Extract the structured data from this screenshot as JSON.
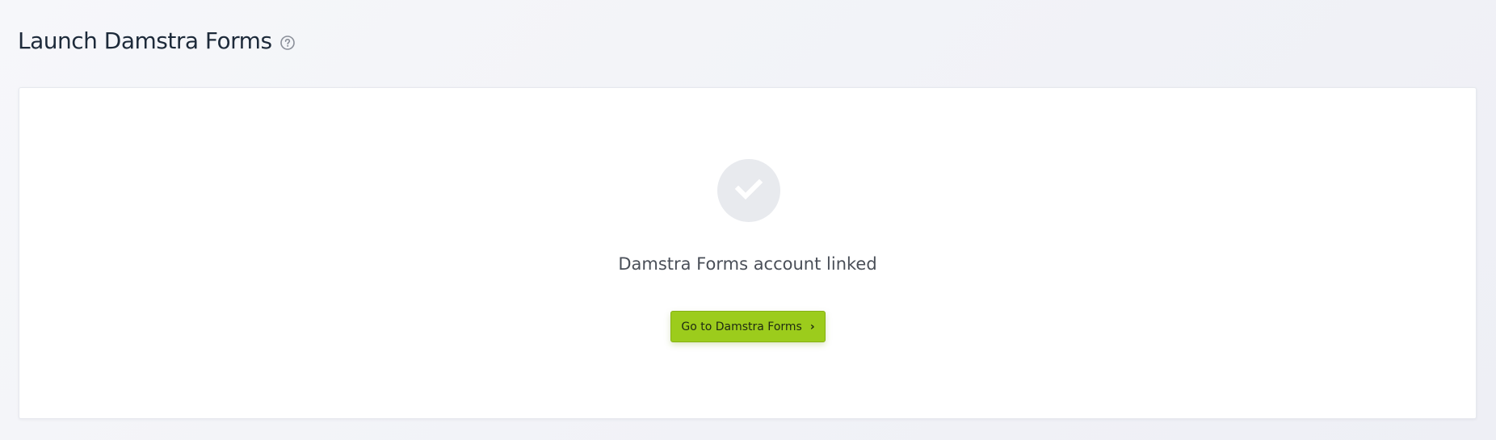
{
  "header": {
    "title": "Launch Damstra Forms",
    "help_icon": "question-circle-icon"
  },
  "card": {
    "status_icon": "check-icon",
    "status_text": "Damstra Forms account linked",
    "button_label": "Go to Damstra Forms",
    "button_chevron": "›",
    "button_color": "#9ccc1c"
  }
}
